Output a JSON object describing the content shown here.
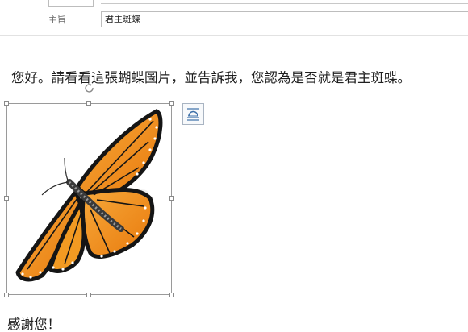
{
  "header": {
    "subject_label": "主旨",
    "subject_value": "君主斑蝶"
  },
  "body": {
    "line1": "您好。請看看這張蝴蝶圖片，並告訴我，您認為是否就是君主斑蝶。",
    "closing": "感謝您！"
  },
  "image": {
    "subject": "monarch-butterfly",
    "selected": true
  },
  "colors": {
    "wing_orange": "#f08a12",
    "wing_orange_light": "#f7a93a",
    "wing_vein": "#1a1a1a",
    "border_gray": "#bdbdbd",
    "layout_button_blue": "#3b6ea8"
  }
}
